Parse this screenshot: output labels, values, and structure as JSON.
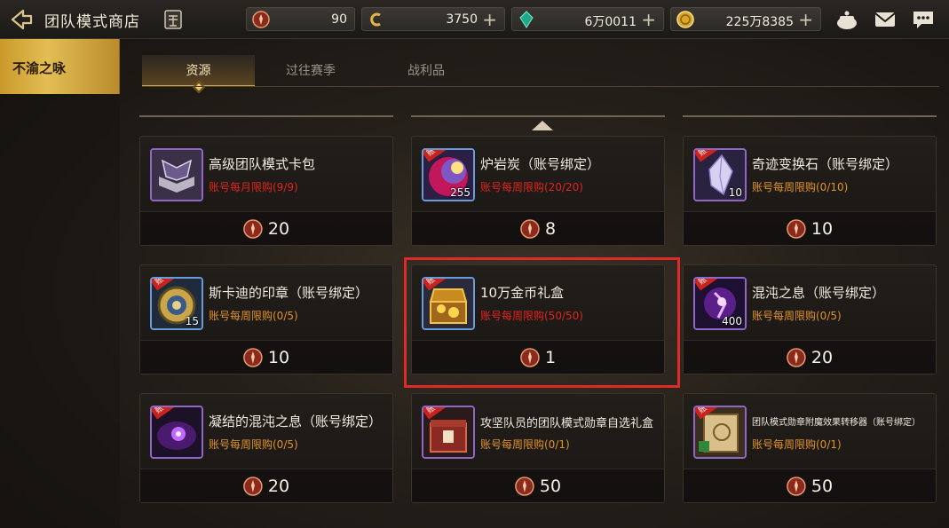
{
  "header": {
    "title": "团队模式商店",
    "currencies": [
      {
        "name": "medal-icon",
        "value": "90",
        "has_plus": false
      },
      {
        "name": "c-coin-icon",
        "value": "3750",
        "has_plus": true
      },
      {
        "name": "gem-icon",
        "value": "6万0011",
        "has_plus": true
      },
      {
        "name": "gold-coin-icon",
        "value": "225万8385",
        "has_plus": true
      }
    ],
    "plus_symbol": "+"
  },
  "sidebar": {
    "active_tab": "不渝之咏"
  },
  "tabs": [
    {
      "label": "资源",
      "active": true
    },
    {
      "label": "过往赛季",
      "active": false
    },
    {
      "label": "战利品",
      "active": false
    }
  ],
  "shop_items": [
    {
      "name": "高级团队模式卡包",
      "limit": "账号每月限购(9/9)",
      "limit_color": "red",
      "price": "20",
      "qty": "",
      "bound": false,
      "icon": "card-pack-icon"
    },
    {
      "name": "炉岩炭（账号绑定）",
      "limit": "账号每周限购(20/20)",
      "limit_color": "red",
      "price": "8",
      "qty": "255",
      "bound": true,
      "icon": "lava-coal-icon"
    },
    {
      "name": "奇迹变换石（账号绑定）",
      "limit": "账号每周限购(0/10)",
      "limit_color": "orange",
      "price": "10",
      "qty": "10",
      "bound": true,
      "icon": "crystal-icon"
    },
    {
      "name": "斯卡迪的印章（账号绑定）",
      "limit": "账号每周限购(0/5)",
      "limit_color": "orange",
      "price": "10",
      "qty": "15",
      "bound": true,
      "icon": "seal-icon"
    },
    {
      "name": "10万金币礼盒",
      "limit": "账号每周限购(50/50)",
      "limit_color": "red",
      "price": "1",
      "qty": "",
      "bound": true,
      "icon": "gold-chest-icon"
    },
    {
      "name": "混沌之息（账号绑定）",
      "limit": "账号每周限购(0/5)",
      "limit_color": "orange",
      "price": "20",
      "qty": "400",
      "bound": true,
      "icon": "chaos-breath-icon"
    },
    {
      "name": "凝结的混沌之息（账号绑定）",
      "limit": "账号每周限购(0/5)",
      "limit_color": "orange",
      "price": "20",
      "qty": "",
      "bound": true,
      "icon": "condensed-chaos-icon"
    },
    {
      "name": "攻坚队员的团队模式勋章自选礼盒",
      "limit": "账号每周限购(0/1)",
      "limit_color": "orange",
      "price": "50",
      "qty": "",
      "bound": true,
      "icon": "medal-box-icon"
    },
    {
      "name": "团队模式勋章附魔效果转移器（账号绑定）",
      "limit": "账号每周限购(0/1)",
      "limit_color": "orange",
      "price": "50",
      "qty": "",
      "bound": true,
      "icon": "transfer-scroll-icon"
    }
  ],
  "bound_ribbon": "账号",
  "colors": {
    "accent_gold": "#d4a94a",
    "limit_red": "#e0241c",
    "limit_orange": "#e0922a",
    "highlight": "#e02a2a"
  }
}
